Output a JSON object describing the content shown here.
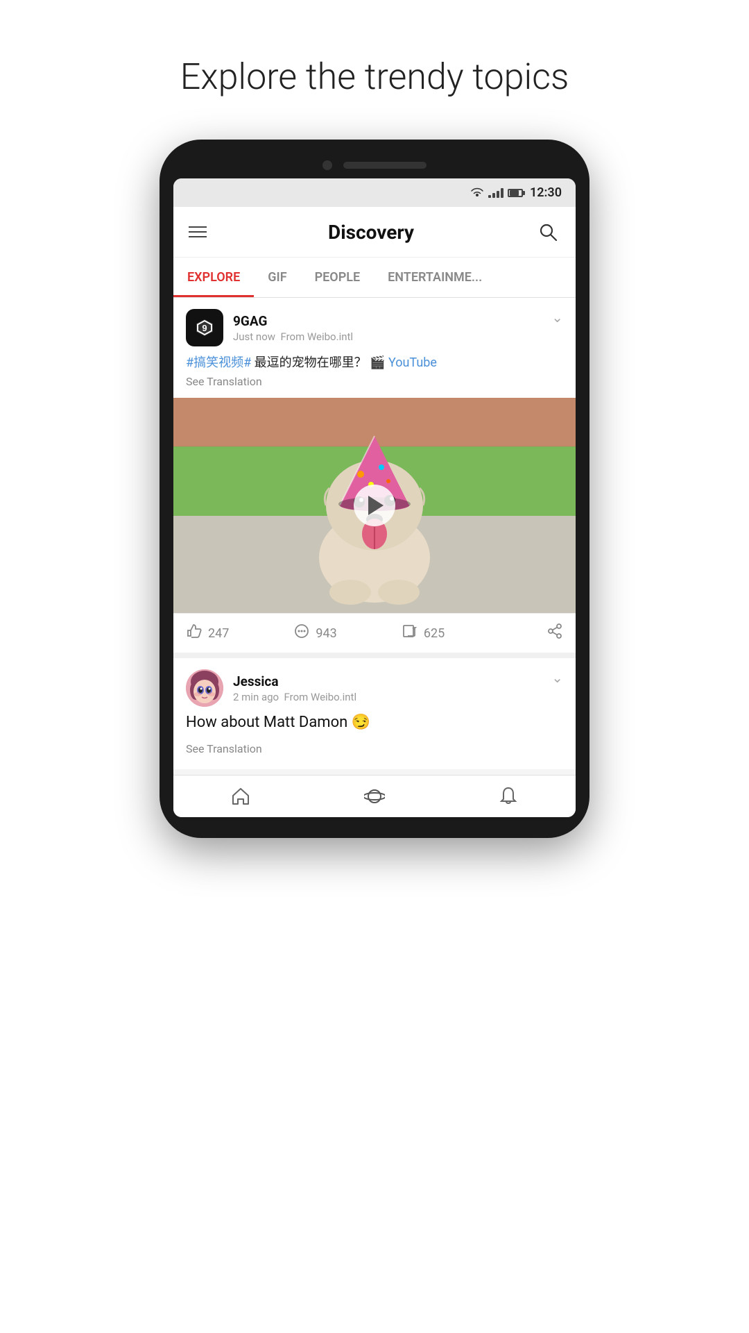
{
  "page": {
    "title": "Explore the trendy topics"
  },
  "status_bar": {
    "time": "12:30"
  },
  "top_bar": {
    "title": "Discovery",
    "search_label": "search"
  },
  "tabs": [
    {
      "id": "explore",
      "label": "EXPLORE",
      "active": true
    },
    {
      "id": "gif",
      "label": "GIF",
      "active": false
    },
    {
      "id": "people",
      "label": "PEOPLE",
      "active": false
    },
    {
      "id": "entertainment",
      "label": "ENTERTAINME...",
      "active": false
    }
  ],
  "posts": [
    {
      "id": "post-1",
      "user": {
        "name": "9GAG",
        "avatar_type": "9gag",
        "time": "Just now",
        "source": "From Weibo.intl"
      },
      "text_parts": [
        {
          "type": "hashtag",
          "text": "#搞笑视频#"
        },
        {
          "type": "normal",
          "text": " 最逗的宠物在哪里？"
        },
        {
          "type": "video_icon",
          "text": "🎬"
        },
        {
          "type": "link",
          "text": " YouTube"
        }
      ],
      "see_translation": "See Translation",
      "has_video": true,
      "actions": {
        "likes": "247",
        "comments": "943",
        "shares": "625"
      }
    },
    {
      "id": "post-2",
      "user": {
        "name": "Jessica",
        "avatar_type": "jessica",
        "time": "2 min ago",
        "source": "From Weibo.intl"
      },
      "text": "How about Matt Damon 😏",
      "see_translation": "See Translation"
    }
  ],
  "bottom_nav": [
    {
      "id": "home",
      "label": "home",
      "icon": "home-icon"
    },
    {
      "id": "discover",
      "label": "discover",
      "icon": "planet-icon"
    },
    {
      "id": "notifications",
      "label": "notifications",
      "icon": "bell-icon"
    }
  ],
  "colors": {
    "active_tab": "#e03030",
    "hashtag": "#4a90d9",
    "link": "#4a90d9"
  }
}
